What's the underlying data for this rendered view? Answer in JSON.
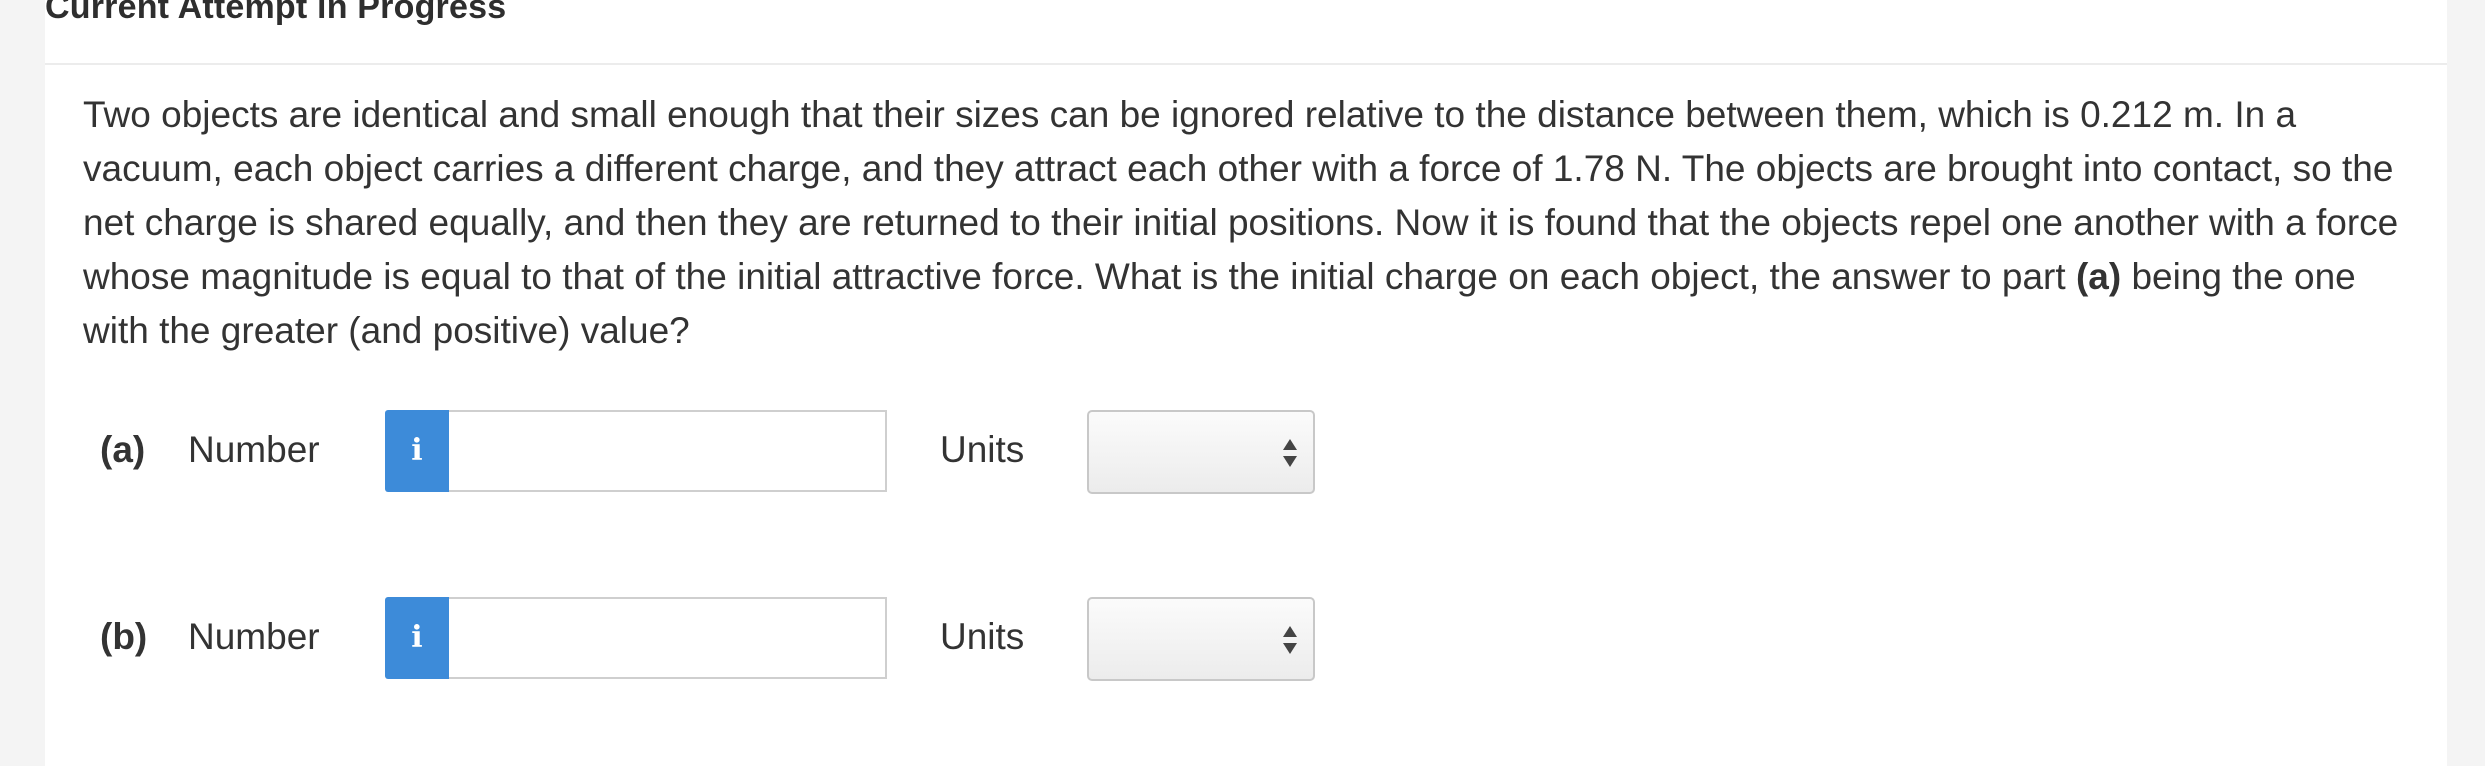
{
  "header": {
    "title": "Current Attempt in Progress"
  },
  "question": {
    "text_part1": "Two objects are identical and small enough that their sizes can be ignored relative to the distance between them, which is 0.212 m. In a vacuum, each object carries a different charge, and they attract each other with a force of 1.78 N. The objects are brought into contact, so the net charge is shared equally, and then they are returned to their initial positions. Now it is found that the objects repel one another with a force whose magnitude is equal to that of the initial attractive force. What is the initial charge on each object, the answer to part ",
    "bold_ref": "(a)",
    "text_part2": " being the one with the greater (and positive) value?"
  },
  "parts": [
    {
      "label": "(a)",
      "number_label": "Number",
      "info_icon": "info-icon",
      "number_value": "",
      "units_label": "Units",
      "units_selected": ""
    },
    {
      "label": "(b)",
      "number_label": "Number",
      "info_icon": "info-icon",
      "number_value": "",
      "units_label": "Units",
      "units_selected": ""
    }
  ],
  "colors": {
    "info_button": "#3d8bd9",
    "page_background": "#f4f4f4",
    "card_background": "#ffffff",
    "text": "#333333"
  }
}
